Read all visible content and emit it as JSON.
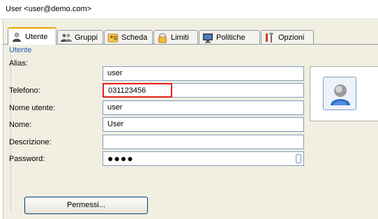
{
  "window": {
    "title": "User <user@demo.com>"
  },
  "tabs": [
    {
      "label": "Utente",
      "icon": "user-icon",
      "active": true
    },
    {
      "label": "Gruppi",
      "icon": "group-icon",
      "active": false
    },
    {
      "label": "Scheda",
      "icon": "card-icon",
      "active": false
    },
    {
      "label": "Limiti",
      "icon": "lock-icon",
      "active": false
    },
    {
      "label": "Politiche",
      "icon": "monitor-icon",
      "active": false
    },
    {
      "label": "Opzioni",
      "icon": "tools-icon",
      "active": false
    }
  ],
  "form": {
    "group_label": "Utente",
    "fields": [
      {
        "label": "Alias:",
        "value": "user"
      },
      {
        "label": "Telefono:",
        "value": "031123456"
      },
      {
        "label": "Nome utente:",
        "value": "user"
      },
      {
        "label": "Nome:",
        "value": "User"
      },
      {
        "label": "Descrizione:",
        "value": ""
      },
      {
        "label": "Password:",
        "value": "●●●●"
      }
    ],
    "permissions_button": "Permessi..."
  },
  "colors": {
    "highlight": "#e81e1e",
    "group_label": "#1f5fb8",
    "active_tab_accent": "#e8a200"
  }
}
